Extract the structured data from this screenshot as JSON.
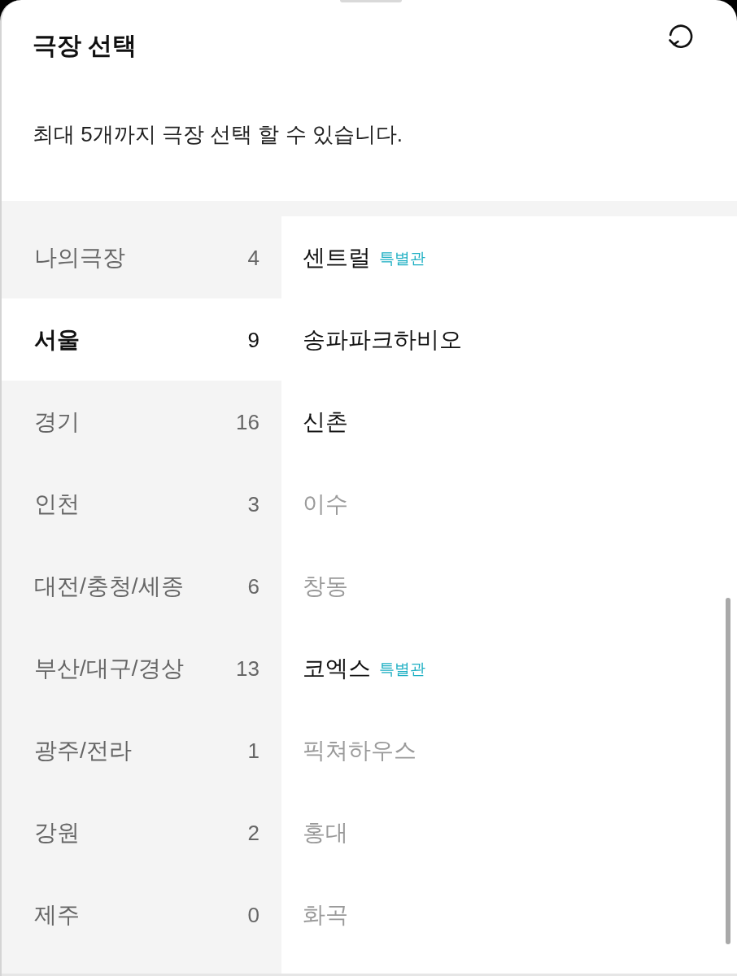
{
  "header": {
    "title": "극장 선택",
    "subtitle": "최대 5개까지 극장 선택 할 수 있습니다."
  },
  "regions": [
    {
      "label": "나의극장",
      "count": "4",
      "selected": false
    },
    {
      "label": "서울",
      "count": "9",
      "selected": true
    },
    {
      "label": "경기",
      "count": "16",
      "selected": false
    },
    {
      "label": "인천",
      "count": "3",
      "selected": false
    },
    {
      "label": "대전/충청/세종",
      "count": "6",
      "selected": false
    },
    {
      "label": "부산/대구/경상",
      "count": "13",
      "selected": false
    },
    {
      "label": "광주/전라",
      "count": "1",
      "selected": false
    },
    {
      "label": "강원",
      "count": "2",
      "selected": false
    },
    {
      "label": "제주",
      "count": "0",
      "selected": false
    }
  ],
  "theaters": [
    {
      "name": "센트럴",
      "badge": "특별관",
      "disabled": false
    },
    {
      "name": "송파파크하비오",
      "disabled": false
    },
    {
      "name": "신촌",
      "disabled": false
    },
    {
      "name": "이수",
      "disabled": true
    },
    {
      "name": "창동",
      "disabled": true
    },
    {
      "name": "코엑스",
      "badge": "특별관",
      "disabled": false
    },
    {
      "name": "픽쳐하우스",
      "disabled": true
    },
    {
      "name": "홍대",
      "disabled": true
    },
    {
      "name": "화곡",
      "disabled": true
    }
  ]
}
